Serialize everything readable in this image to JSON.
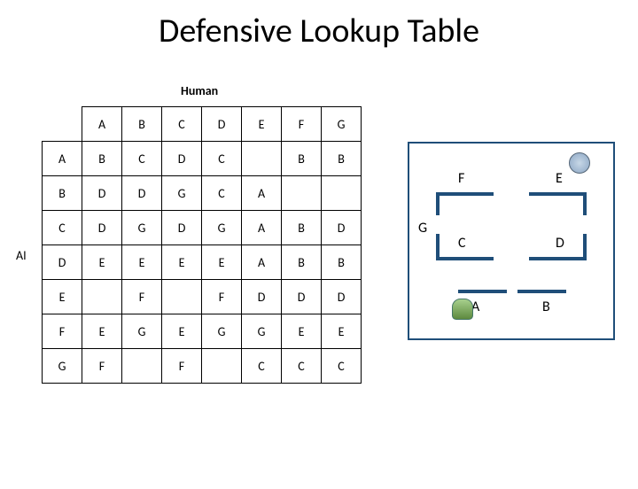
{
  "title": "Defensive Lookup Table",
  "labels": {
    "human": "Human",
    "ai": "AI"
  },
  "columns": [
    "A",
    "B",
    "C",
    "D",
    "E",
    "F",
    "G"
  ],
  "rows": [
    "A",
    "B",
    "C",
    "D",
    "E",
    "F",
    "G"
  ],
  "table": {
    "A": [
      "B",
      "C",
      "D",
      "C",
      "",
      "B",
      "B"
    ],
    "B": [
      "D",
      "D",
      "G",
      "C",
      "A",
      "",
      ""
    ],
    "C": [
      "D",
      "G",
      "D",
      "G",
      "A",
      "B",
      "D"
    ],
    "D": [
      "E",
      "E",
      "E",
      "E",
      "A",
      "B",
      "B"
    ],
    "E": [
      "",
      "F",
      "",
      "F",
      "D",
      "D",
      "D"
    ],
    "F": [
      "E",
      "G",
      "E",
      "G",
      "G",
      "E",
      "E"
    ],
    "G": [
      "F",
      "",
      "F",
      "",
      "C",
      "C",
      "C"
    ]
  },
  "board": {
    "center": "G",
    "zones": {
      "top_left": "F",
      "top_right": "E",
      "mid_left": "C",
      "mid_right": "D",
      "bot_left": "A",
      "bot_right": "B"
    },
    "sprites": {
      "robot": "top_right",
      "player": "bot_left"
    }
  }
}
